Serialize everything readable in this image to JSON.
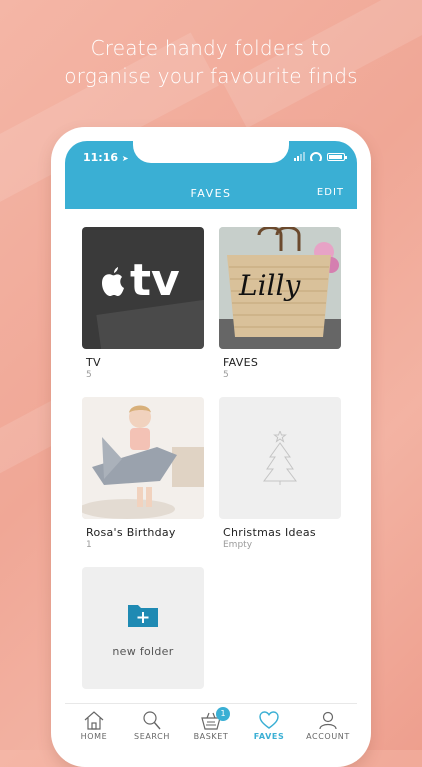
{
  "headline": {
    "line1": "Create handy folders to",
    "line2": "organise your favourite finds"
  },
  "status_bar": {
    "time": "11:16"
  },
  "header": {
    "title": "FAVES",
    "edit_label": "EDIT"
  },
  "folders": [
    {
      "name": "TV",
      "count": "5"
    },
    {
      "name": "FAVES",
      "count": "5"
    },
    {
      "name": "Rosa's Birthday",
      "count": "1"
    },
    {
      "name": "Christmas Ideas",
      "count": "Empty"
    }
  ],
  "thumbs": {
    "tv_logo_text": "tv",
    "bag_text": "Lilly"
  },
  "new_folder": {
    "label": "new folder"
  },
  "tabbar": {
    "items": [
      {
        "label": "HOME",
        "icon": "home-icon"
      },
      {
        "label": "SEARCH",
        "icon": "search-icon"
      },
      {
        "label": "BASKET",
        "icon": "basket-icon",
        "badge": "1"
      },
      {
        "label": "FAVES",
        "icon": "heart-icon",
        "active": true
      },
      {
        "label": "ACCOUNT",
        "icon": "account-icon"
      }
    ]
  },
  "colors": {
    "accent": "#3aafd4",
    "background": "#f2ab9b",
    "folder_empty": "#efefef",
    "new_folder_icon": "#1f8ab3"
  }
}
